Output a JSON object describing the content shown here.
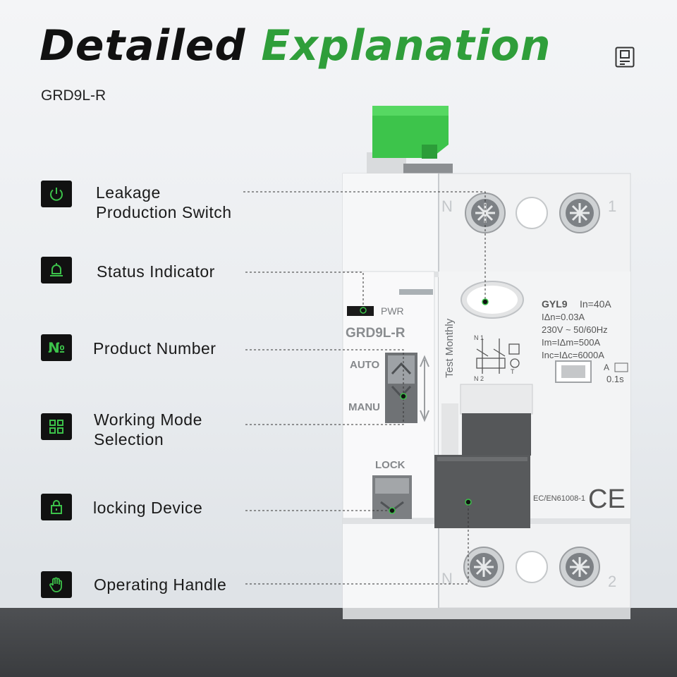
{
  "header": {
    "title_part1": "Detailed",
    "title_part2": "Explanation",
    "model": "GRD9L-R"
  },
  "features": [
    {
      "icon": "power-icon",
      "line1": "Leakage",
      "line2": "Production Switch"
    },
    {
      "icon": "bell-icon",
      "line1": "Status Indicator",
      "line2": ""
    },
    {
      "icon": "numero-icon",
      "line1": "Product Number",
      "line2": ""
    },
    {
      "icon": "grid-icon",
      "line1": "Working Mode",
      "line2": "Selection"
    },
    {
      "icon": "lock-icon",
      "line1": "locking Device",
      "line2": ""
    },
    {
      "icon": "hand-icon",
      "line1": "Operating Handle",
      "line2": ""
    }
  ],
  "device": {
    "pwr": "PWR",
    "model_label": "GRD9L-R",
    "auto": "AUTO",
    "manu": "MANU",
    "lock": "LOCK",
    "test": "Test Monthly",
    "terminal_n_top": "N",
    "terminal_1": "1",
    "terminal_n_bottom": "N",
    "terminal_2": "2",
    "spec_series": "GYL9",
    "spec_in": "In=40A",
    "spec_idn": "IΔn=0.03A",
    "spec_voltage": "230V ~ 50/60Hz",
    "spec_im": "Im=IΔm=500A",
    "spec_inc": "Inc=IΔc=6000A",
    "spec_a": "A",
    "spec_time": "0.1s",
    "standard": "EC/EN61008-1",
    "ce": "CE",
    "schematic_top": "N 1",
    "schematic_bottom": "N 2",
    "schematic_t": "T"
  },
  "colors": {
    "accent_green": "#2f9e3a",
    "icon_green": "#3cc24a",
    "device_green": "#3dc44b",
    "icon_bg": "#111111"
  }
}
